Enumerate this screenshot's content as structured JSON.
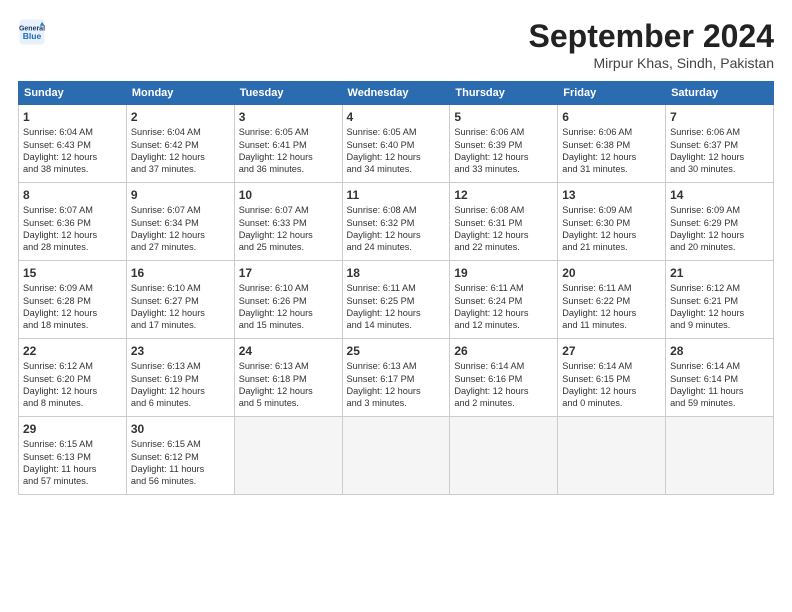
{
  "header": {
    "logo_line1": "General",
    "logo_line2": "Blue",
    "month_title": "September 2024",
    "location": "Mirpur Khas, Sindh, Pakistan"
  },
  "days_of_week": [
    "Sunday",
    "Monday",
    "Tuesday",
    "Wednesday",
    "Thursday",
    "Friday",
    "Saturday"
  ],
  "weeks": [
    [
      {
        "day": "1",
        "info": "Sunrise: 6:04 AM\nSunset: 6:43 PM\nDaylight: 12 hours\nand 38 minutes."
      },
      {
        "day": "2",
        "info": "Sunrise: 6:04 AM\nSunset: 6:42 PM\nDaylight: 12 hours\nand 37 minutes."
      },
      {
        "day": "3",
        "info": "Sunrise: 6:05 AM\nSunset: 6:41 PM\nDaylight: 12 hours\nand 36 minutes."
      },
      {
        "day": "4",
        "info": "Sunrise: 6:05 AM\nSunset: 6:40 PM\nDaylight: 12 hours\nand 34 minutes."
      },
      {
        "day": "5",
        "info": "Sunrise: 6:06 AM\nSunset: 6:39 PM\nDaylight: 12 hours\nand 33 minutes."
      },
      {
        "day": "6",
        "info": "Sunrise: 6:06 AM\nSunset: 6:38 PM\nDaylight: 12 hours\nand 31 minutes."
      },
      {
        "day": "7",
        "info": "Sunrise: 6:06 AM\nSunset: 6:37 PM\nDaylight: 12 hours\nand 30 minutes."
      }
    ],
    [
      {
        "day": "8",
        "info": "Sunrise: 6:07 AM\nSunset: 6:36 PM\nDaylight: 12 hours\nand 28 minutes."
      },
      {
        "day": "9",
        "info": "Sunrise: 6:07 AM\nSunset: 6:34 PM\nDaylight: 12 hours\nand 27 minutes."
      },
      {
        "day": "10",
        "info": "Sunrise: 6:07 AM\nSunset: 6:33 PM\nDaylight: 12 hours\nand 25 minutes."
      },
      {
        "day": "11",
        "info": "Sunrise: 6:08 AM\nSunset: 6:32 PM\nDaylight: 12 hours\nand 24 minutes."
      },
      {
        "day": "12",
        "info": "Sunrise: 6:08 AM\nSunset: 6:31 PM\nDaylight: 12 hours\nand 22 minutes."
      },
      {
        "day": "13",
        "info": "Sunrise: 6:09 AM\nSunset: 6:30 PM\nDaylight: 12 hours\nand 21 minutes."
      },
      {
        "day": "14",
        "info": "Sunrise: 6:09 AM\nSunset: 6:29 PM\nDaylight: 12 hours\nand 20 minutes."
      }
    ],
    [
      {
        "day": "15",
        "info": "Sunrise: 6:09 AM\nSunset: 6:28 PM\nDaylight: 12 hours\nand 18 minutes."
      },
      {
        "day": "16",
        "info": "Sunrise: 6:10 AM\nSunset: 6:27 PM\nDaylight: 12 hours\nand 17 minutes."
      },
      {
        "day": "17",
        "info": "Sunrise: 6:10 AM\nSunset: 6:26 PM\nDaylight: 12 hours\nand 15 minutes."
      },
      {
        "day": "18",
        "info": "Sunrise: 6:11 AM\nSunset: 6:25 PM\nDaylight: 12 hours\nand 14 minutes."
      },
      {
        "day": "19",
        "info": "Sunrise: 6:11 AM\nSunset: 6:24 PM\nDaylight: 12 hours\nand 12 minutes."
      },
      {
        "day": "20",
        "info": "Sunrise: 6:11 AM\nSunset: 6:22 PM\nDaylight: 12 hours\nand 11 minutes."
      },
      {
        "day": "21",
        "info": "Sunrise: 6:12 AM\nSunset: 6:21 PM\nDaylight: 12 hours\nand 9 minutes."
      }
    ],
    [
      {
        "day": "22",
        "info": "Sunrise: 6:12 AM\nSunset: 6:20 PM\nDaylight: 12 hours\nand 8 minutes."
      },
      {
        "day": "23",
        "info": "Sunrise: 6:13 AM\nSunset: 6:19 PM\nDaylight: 12 hours\nand 6 minutes."
      },
      {
        "day": "24",
        "info": "Sunrise: 6:13 AM\nSunset: 6:18 PM\nDaylight: 12 hours\nand 5 minutes."
      },
      {
        "day": "25",
        "info": "Sunrise: 6:13 AM\nSunset: 6:17 PM\nDaylight: 12 hours\nand 3 minutes."
      },
      {
        "day": "26",
        "info": "Sunrise: 6:14 AM\nSunset: 6:16 PM\nDaylight: 12 hours\nand 2 minutes."
      },
      {
        "day": "27",
        "info": "Sunrise: 6:14 AM\nSunset: 6:15 PM\nDaylight: 12 hours\nand 0 minutes."
      },
      {
        "day": "28",
        "info": "Sunrise: 6:14 AM\nSunset: 6:14 PM\nDaylight: 11 hours\nand 59 minutes."
      }
    ],
    [
      {
        "day": "29",
        "info": "Sunrise: 6:15 AM\nSunset: 6:13 PM\nDaylight: 11 hours\nand 57 minutes."
      },
      {
        "day": "30",
        "info": "Sunrise: 6:15 AM\nSunset: 6:12 PM\nDaylight: 11 hours\nand 56 minutes."
      },
      {
        "day": "",
        "info": ""
      },
      {
        "day": "",
        "info": ""
      },
      {
        "day": "",
        "info": ""
      },
      {
        "day": "",
        "info": ""
      },
      {
        "day": "",
        "info": ""
      }
    ]
  ]
}
